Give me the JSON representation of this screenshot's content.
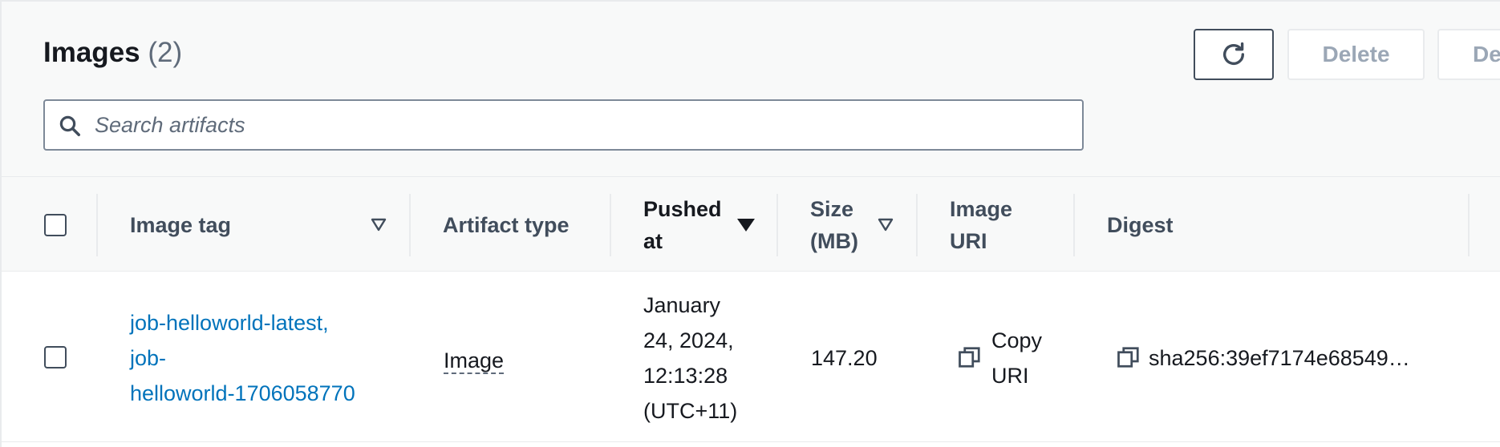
{
  "header": {
    "title": "Images",
    "count": "(2)",
    "buttons": {
      "refresh_icon": "refresh-icon",
      "delete_label": "Delete",
      "details_label": "Det"
    },
    "search": {
      "placeholder": "Search artifacts",
      "value": ""
    }
  },
  "table": {
    "columns": {
      "image_tag": "Image tag",
      "artifact_type": "Artifact type",
      "pushed_at_line1": "Pushed",
      "pushed_at_line2": "at",
      "size_line1": "Size",
      "size_line2": "(MB)",
      "image_uri_line1": "Image",
      "image_uri_line2": "URI",
      "digest": "Digest"
    },
    "rows": [
      {
        "image_tag_line1": "job-helloworld-latest,",
        "image_tag_line2": "job-",
        "image_tag_line3": "helloworld-1706058770",
        "artifact_type": "Image",
        "pushed_line1": "January",
        "pushed_line2": "24, 2024,",
        "pushed_line3": "12:13:28",
        "pushed_line4": "(UTC+11)",
        "size": "147.20",
        "uri_line1": "Copy",
        "uri_line2": "URI",
        "digest": "sha256:39ef7174e68549…"
      }
    ]
  },
  "colors": {
    "link": "#0073bb",
    "header_bg": "#f8f9f9",
    "text": "#16191f",
    "muted": "#5f6b7a"
  }
}
